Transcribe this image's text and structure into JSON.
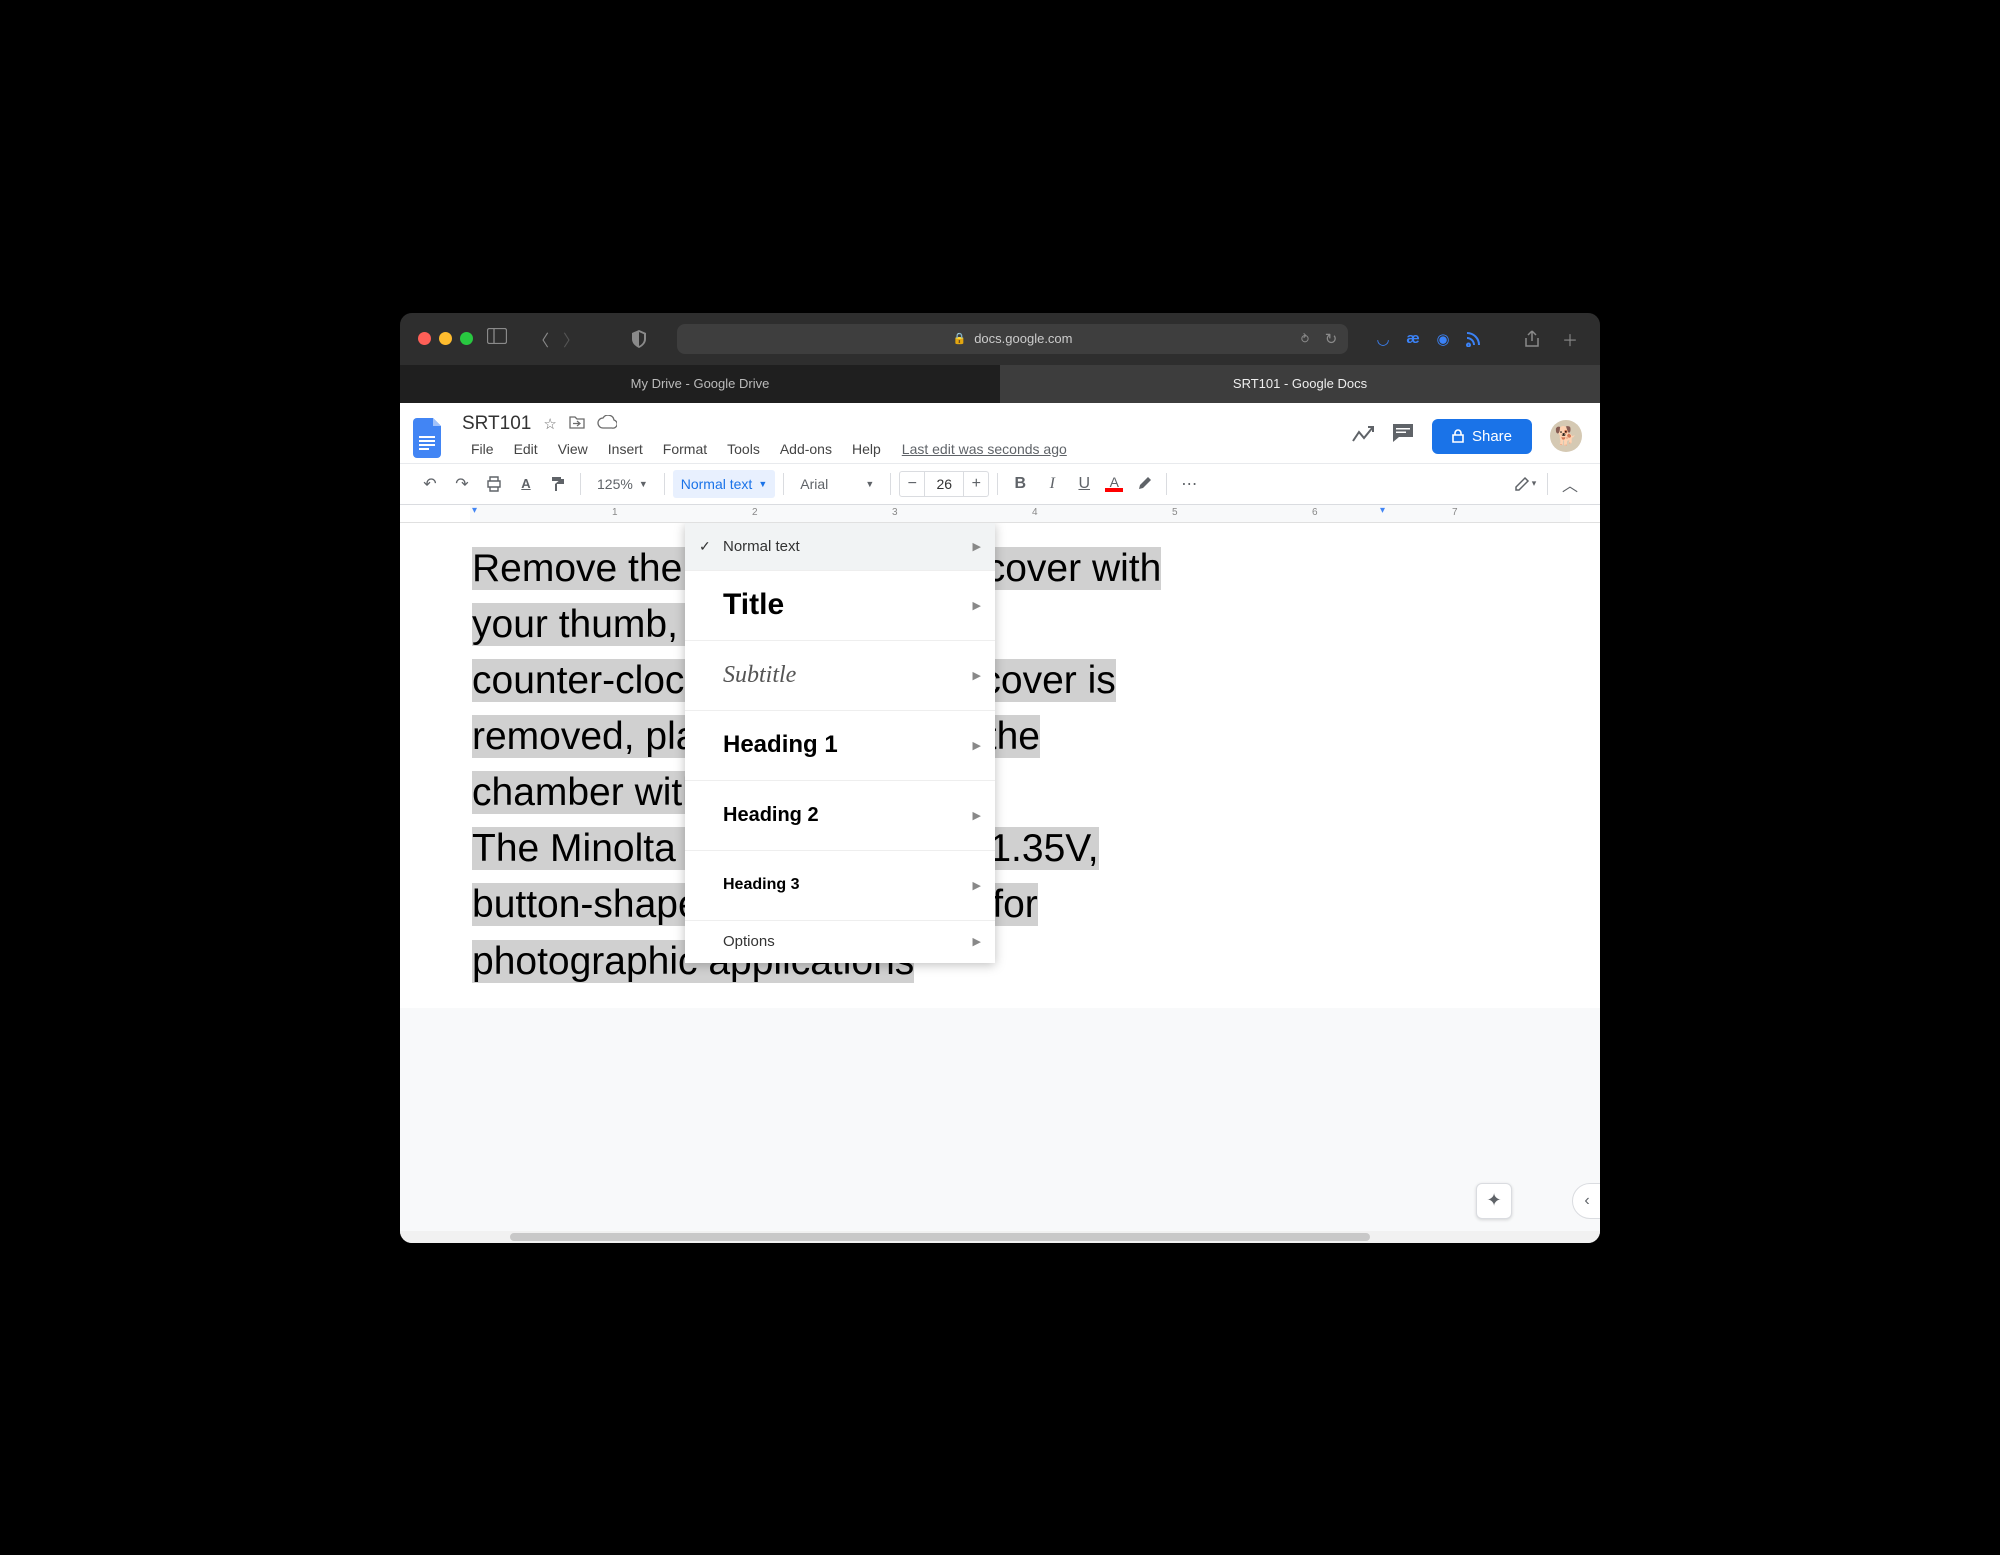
{
  "browser": {
    "url_host": "docs.google.com",
    "tabs": [
      {
        "label": "My Drive - Google Drive",
        "active": false
      },
      {
        "label": "SRT101 - Google Docs",
        "active": true
      }
    ]
  },
  "docs": {
    "title": "SRT101",
    "menus": [
      "File",
      "Edit",
      "View",
      "Insert",
      "Format",
      "Tools",
      "Add-ons",
      "Help"
    ],
    "last_edit": "Last edit was seconds ago",
    "share_label": "Share"
  },
  "toolbar": {
    "zoom": "125%",
    "paragraph_style": "Normal text",
    "font": "Arial",
    "font_size": "26"
  },
  "style_menu": {
    "items": [
      {
        "label": "Normal text",
        "cls": "sl-normal",
        "checked": true,
        "hovered": true
      },
      {
        "label": "Title",
        "cls": "sl-title",
        "checked": false
      },
      {
        "label": "Subtitle",
        "cls": "sl-subtitle",
        "checked": false
      },
      {
        "label": "Heading 1",
        "cls": "sl-h1",
        "checked": false
      },
      {
        "label": "Heading 2",
        "cls": "sl-h2",
        "checked": false
      },
      {
        "label": "Heading 3",
        "cls": "sl-h3",
        "checked": false
      }
    ],
    "options_label": "Options"
  },
  "ruler": {
    "marks": [
      "1",
      "2",
      "3",
      "4",
      "5",
      "6",
      "7"
    ]
  },
  "document": {
    "line1": "Remove the battery chamber cover with",
    "line2": "your thumb, turning it",
    "line3": "counter-clockwise. When the cover is",
    "line4": "removed, place the battery in the",
    "line5": "chamber with the \"+\" side up.",
    "line6": "The Minolta SR-T 101 uses a 1.35V,",
    "line7": "button-shape mercury battery for",
    "line8": "photographic applications"
  }
}
